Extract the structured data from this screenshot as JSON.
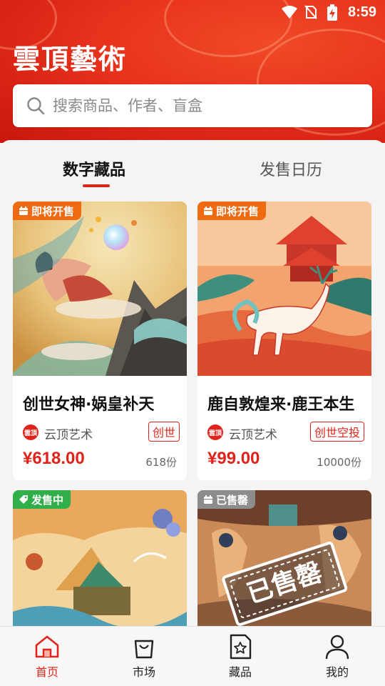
{
  "status_bar": {
    "time": "8:59"
  },
  "header": {
    "logo": "雲頂藝術",
    "search_placeholder": "搜索商品、作者、盲盒"
  },
  "tabs": [
    {
      "label": "数字藏品",
      "active": true
    },
    {
      "label": "发售日历",
      "active": false
    }
  ],
  "cards": [
    {
      "badge": "即将开售",
      "badge_color": "#f06a12",
      "title": "创世女神·娲皇补天",
      "creator": "云顶艺术",
      "tag": "创世",
      "price": "¥618.00",
      "quantity": "618份"
    },
    {
      "badge": "即将开售",
      "badge_color": "#f06a12",
      "title": "鹿自敦煌来·鹿王本生",
      "creator": "云顶艺术",
      "tag": "创世空投",
      "price": "¥99.00",
      "quantity": "10000份"
    },
    {
      "badge": "发售中",
      "badge_color": "#2fae4a"
    },
    {
      "badge": "已售罄",
      "badge_color": "#8d8d8d",
      "stamp": "已售罄"
    }
  ],
  "bottom_nav": [
    {
      "label": "首页",
      "icon": "home-icon",
      "active": true
    },
    {
      "label": "市场",
      "icon": "shopping-bag-icon",
      "active": false
    },
    {
      "label": "藏品",
      "icon": "collection-star-icon",
      "active": false
    },
    {
      "label": "我的",
      "icon": "profile-icon",
      "active": false
    }
  ],
  "colors": {
    "brand_red": "#e0241b",
    "header_red": "#e8321c"
  }
}
